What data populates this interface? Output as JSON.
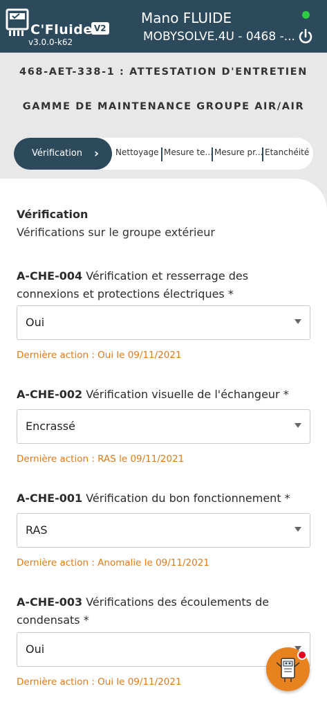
{
  "header": {
    "brand": "C'Fluide",
    "badge": "V2",
    "version": "v3.0.0-k62",
    "user": "Mano FLUIDE",
    "company": "MOBYSOLVE.4U - 0468 -...",
    "status_color": "#2ecc40",
    "icons": {
      "logo": "cfluide-logo-icon",
      "power": "power-icon"
    }
  },
  "titles": {
    "reference": "468-AET-338-1 : ATTESTATION D'ENTRETIEN",
    "range": "GAMME DE MAINTENANCE GROUPE AIR/AIR"
  },
  "stepper": {
    "active": "Vérification",
    "steps": [
      "Nettoyage",
      "Mesure te...",
      "Mesure pr...",
      "Etanchéité"
    ]
  },
  "section": {
    "title": "Vérification",
    "subtitle": "Vérifications sur le groupe extérieur"
  },
  "questions": [
    {
      "code": "A-CHE-004",
      "text": "Vérification et resserrage des connexions et protections électriques *",
      "value": "Oui",
      "last": "Dernière action : Oui le 09/11/2021"
    },
    {
      "code": "A-CHE-002",
      "text": "Vérification visuelle de l'échangeur *",
      "value": "Encrassé",
      "last": "Dernière action : RAS le 09/11/2021"
    },
    {
      "code": "A-CHE-001",
      "text": "Vérification du bon fonctionnement *",
      "value": "RAS",
      "last": "Dernière action : Anomalie le 09/11/2021"
    },
    {
      "code": "A-CHE-003",
      "text": "Vérifications des écoulements de condensats *",
      "value": "Oui",
      "last": "Dernière action : Oui le 09/11/2021"
    }
  ],
  "colors": {
    "primary": "#2d4a5c",
    "accent": "#e8821e",
    "last_action": "#e07b1a",
    "notification": "#e8001c"
  },
  "fab": {
    "icon": "assistant-robot-icon"
  }
}
